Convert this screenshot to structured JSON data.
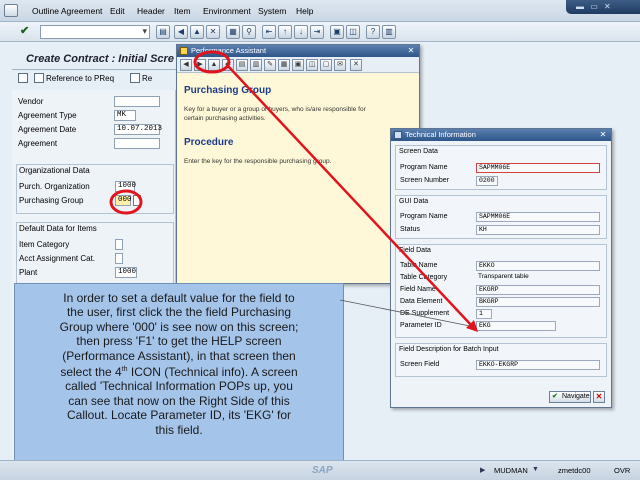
{
  "menubar": {
    "items": [
      "Outline Agreement",
      "Edit",
      "Header",
      "Item",
      "Environment",
      "System",
      "Help"
    ],
    "underline": [
      "O",
      "E",
      "a",
      "I",
      "n",
      "S",
      "H"
    ]
  },
  "screen": {
    "title": "Create Contract : Initial Scre",
    "app_buttons": [
      "Reference to PReq",
      "Re"
    ]
  },
  "form": {
    "vendor_label": "Vendor",
    "agreement_type_label": "Agreement Type",
    "agreement_type_value": "MK",
    "agreement_date_label": "Agreement Date",
    "agreement_date_value": "10.07.2013",
    "agreement_label": "Agreement",
    "org_title": "Organizational Data",
    "purch_org_label": "Purch. Organization",
    "purch_org_value": "1000",
    "purch_group_label": "Purchasing Group",
    "purch_group_value": "000",
    "defaults_title": "Default Data for Items",
    "item_category_label": "Item Category",
    "acct_assign_label": "Acct Assignment Cat.",
    "plant_label": "Plant",
    "plant_value": "1000"
  },
  "perf": {
    "title": "Performance Assistant",
    "heading1": "Purchasing Group",
    "text1": "Key for a buyer or a group of buyers, who is/are responsible for certain purchasing activities.",
    "heading2": "Procedure",
    "text2": "Enter the key for the responsible purchasing group."
  },
  "tech": {
    "title": "Technical Information",
    "screen_data_title": "Screen Data",
    "program_name_label": "Program Name",
    "program_name_value": "SAPMM06E",
    "screen_number_label": "Screen Number",
    "screen_number_value": "0200",
    "gui_data_title": "GUI Data",
    "gui_program_label": "Program Name",
    "gui_program_value": "SAPMM06E",
    "status_label": "Status",
    "status_value": "KH",
    "field_data_title": "Field Data",
    "table_name_label": "Table Name",
    "table_name_value": "EKKO",
    "table_category_label": "Table Category",
    "table_category_value": "Transparent table",
    "field_name_label": "Field Name",
    "field_name_value": "EKGRP",
    "data_element_label": "Data Element",
    "data_element_value": "BKGRP",
    "de_supplement_label": "DE Supplement",
    "de_supplement_value": "1",
    "parameter_id_label": "Parameter ID",
    "parameter_id_value": "EKG",
    "batch_title": "Field Description for Batch Input",
    "screen_field_label": "Screen Field",
    "screen_field_value": "EKKO-EKGRP",
    "navigate_label": "Navigate"
  },
  "callout": {
    "line1": "In order to set a default value for the field to",
    "line2": "the user, first click the the field Purchasing",
    "line3": "Group where '000' is see now on this screen;",
    "line4": "then press 'F1' to get the HELP screen",
    "line5": "(Performance Assistant), in that screen then",
    "line6a": "select the 4",
    "line6sup": "th",
    "line6b": " ICON (Technical info). A screen",
    "line7": "called 'Technical Information POPs up, you",
    "line8": "can see that now on the Right Side of this",
    "line9": "Callout. Locate Parameter ID, its 'EKG' for",
    "line10": "this field."
  },
  "status": {
    "logo": "SAP",
    "user": "MUDMAN",
    "server": "zmetdc00",
    "mode": "OVR"
  },
  "colors": {
    "annotation": "#e0141e",
    "callout_bg": "#a5c4ea"
  }
}
